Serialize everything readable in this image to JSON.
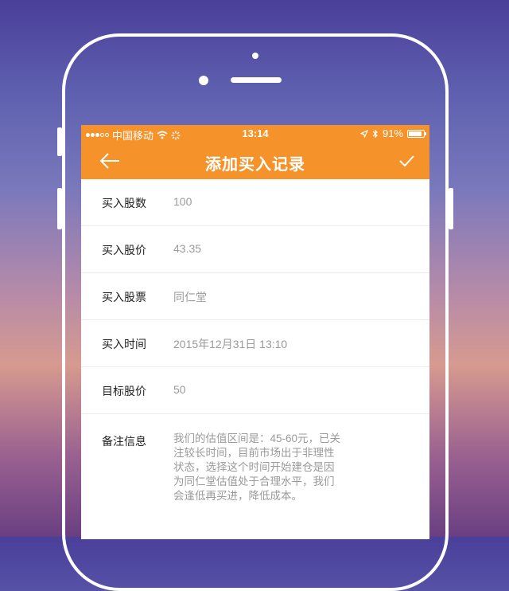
{
  "status_bar": {
    "carrier": "中国移动",
    "time": "13:14",
    "battery": "91%",
    "battery_level": 0.91
  },
  "navbar": {
    "title": "添加买入记录",
    "back_icon": "arrow-left-icon",
    "confirm_icon": "checkmark-icon"
  },
  "form": [
    {
      "label": "买入股数",
      "value": "100"
    },
    {
      "label": "买入股价",
      "value": "43.35"
    },
    {
      "label": "买入股票",
      "value": "同仁堂"
    },
    {
      "label": "买入时间",
      "value": "2015年12月31日 13:10"
    },
    {
      "label": "目标股价",
      "value": "50"
    },
    {
      "label": "备注信息",
      "value": "我们的估值区间是：45-60元，已关注较长时间，目前市场出于非理性状态，选择这个时间开始建仓是因为同仁堂估值处于合理水平，我们会逢低再买进，降低成本。"
    }
  ],
  "colors": {
    "accent": "#f5922a",
    "label": "#222222",
    "value": "#9a9a9a"
  }
}
